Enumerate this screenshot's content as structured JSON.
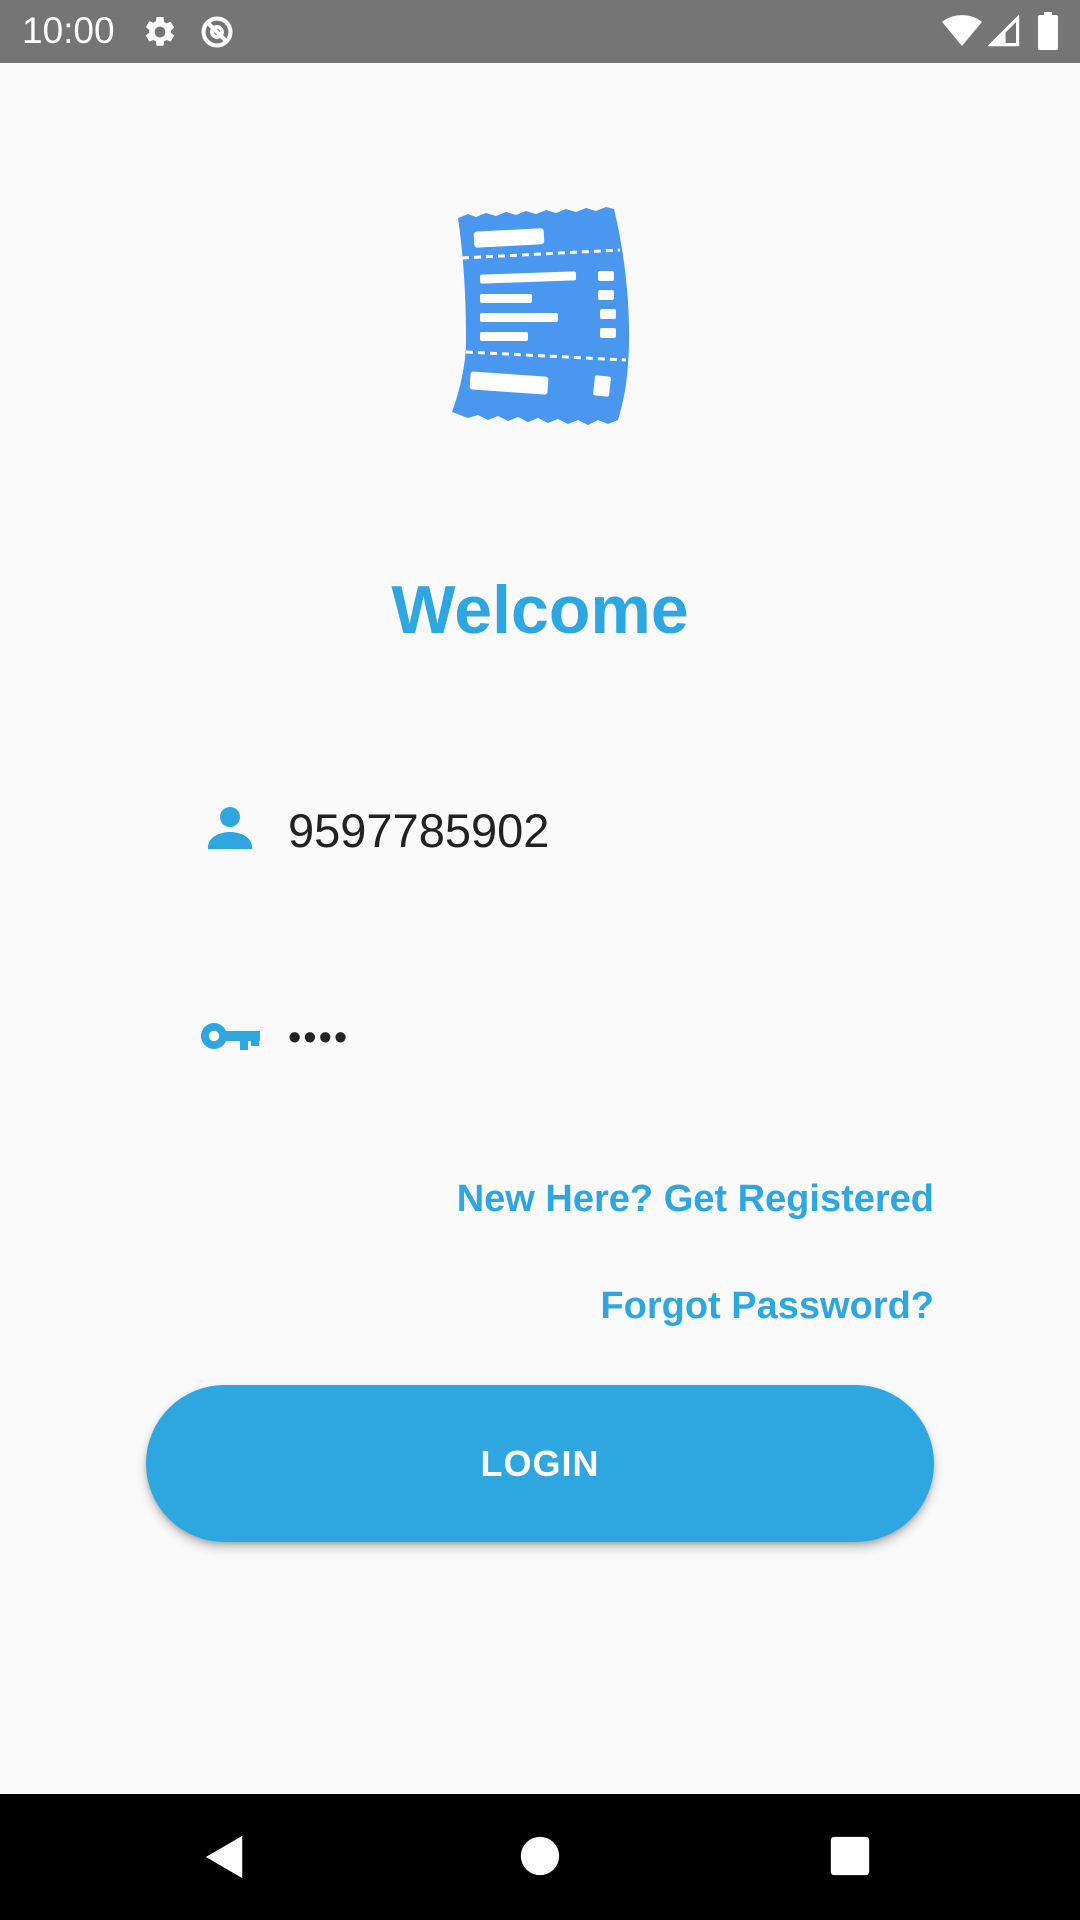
{
  "status_bar": {
    "time": "10:00",
    "left_icons": [
      "gear-icon",
      "data-saver-icon"
    ],
    "right_icons": [
      "wifi-icon",
      "cell-signal-icon",
      "battery-icon"
    ],
    "background": "#757575"
  },
  "logo": {
    "icon": "receipt-icon",
    "color": "#4a97f0"
  },
  "welcome": {
    "title": "Welcome",
    "color": "#2ea7e0"
  },
  "login_form": {
    "username": {
      "icon": "person-icon",
      "value": "9597785902"
    },
    "password": {
      "icon": "key-icon",
      "masked_value": "••••"
    },
    "register_link": "New Here? Get Registered",
    "forgot_link": "Forgot Password?",
    "login_button": "LOGIN",
    "accent_color": "#2ea7e0"
  },
  "nav_bar": {
    "buttons": [
      "back-icon",
      "home-icon",
      "recents-icon"
    ],
    "background": "#000000"
  }
}
